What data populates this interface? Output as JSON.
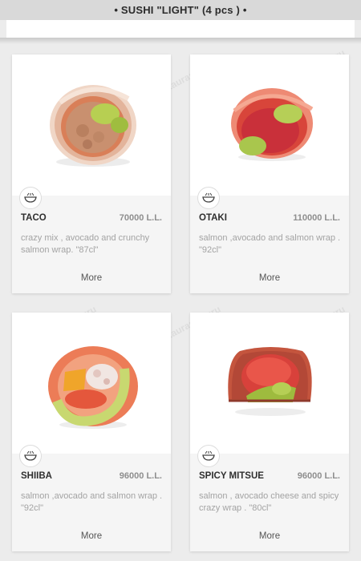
{
  "header": {
    "title": "• SUSHI \"LIGHT\" (4 pcs ) •"
  },
  "watermark": "Restaurant Guru",
  "items": [
    {
      "name": "TACO",
      "price": "70000 L.L.",
      "description": "crazy mix , avocado and crunchy salmon wrap. \"87cl\"",
      "more": "More"
    },
    {
      "name": "OTAKI",
      "price": "110000 L.L.",
      "description": "salmon ,avocado and salmon wrap . \"92cl\"",
      "more": "More"
    },
    {
      "name": "SHIIBA",
      "price": "96000 L.L.",
      "description": "salmon ,avocado and salmon wrap . \"92cl\"",
      "more": "More"
    },
    {
      "name": "SPICY MITSUE",
      "price": "96000 L.L.",
      "description": "salmon , avocado cheese and spicy crazy wrap . \"80cl\"",
      "more": "More"
    }
  ],
  "colors": {
    "topbar": "#d9d9d9",
    "card": "#ffffff",
    "card_body": "#f5f5f5",
    "salmon": "#e56f4f",
    "avocado": "#a6c24a"
  }
}
